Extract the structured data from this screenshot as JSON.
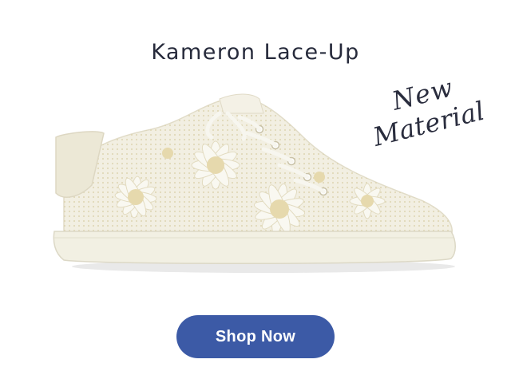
{
  "product": {
    "title": "Kameron Lace-Up"
  },
  "badge": {
    "line1": "New",
    "line2": "Material"
  },
  "cta": {
    "label": "Shop Now"
  },
  "colors": {
    "title": "#262a3b",
    "button": "#3c5aa6",
    "button_text": "#ffffff",
    "shoe_body": "#f1eedf",
    "shoe_sole": "#f2f0e3"
  },
  "icons": {
    "product_image": "sneaker-image"
  }
}
